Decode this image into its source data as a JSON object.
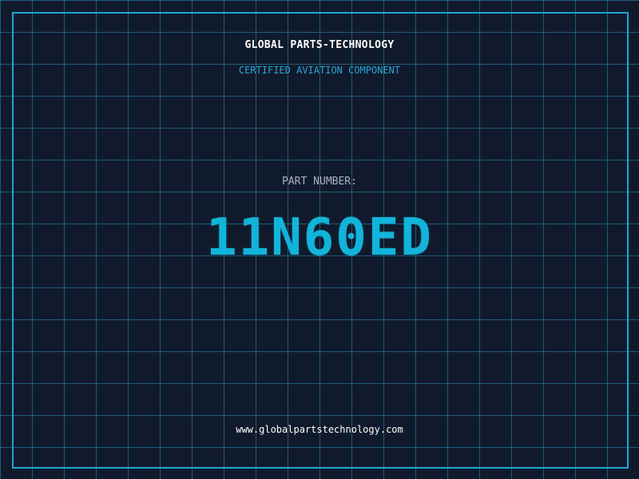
{
  "header": {
    "company_name": "GLOBAL PARTS-TECHNOLOGY",
    "tagline": "CERTIFIED AVIATION COMPONENT"
  },
  "part": {
    "label": "PART NUMBER:",
    "number": "11N60ED"
  },
  "footer": {
    "website": "www.globalpartstechnology.com"
  },
  "colors": {
    "background": "#111a2c",
    "grid": "#2096b9",
    "frame": "#1da7cf",
    "accent": "#12b4da",
    "label": "#a9b3c3",
    "text": "#ffffff"
  }
}
